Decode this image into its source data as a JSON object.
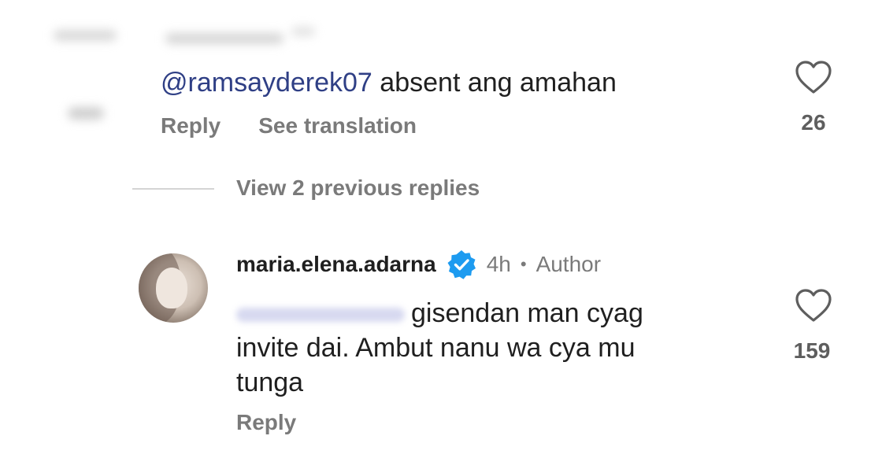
{
  "comment1": {
    "mention": "@ramsayderek07",
    "text": " absent ang amahan",
    "actions": {
      "reply": "Reply",
      "translate": "See translation"
    },
    "likes": "26"
  },
  "view_replies": "View 2 previous replies",
  "reply": {
    "username": "maria.elena.adarna",
    "time": "4h",
    "separator": "•",
    "badge": "Author",
    "text_line1": "gisendan man cyag",
    "text_line2": "invite dai. Ambut nanu wa cya mu",
    "text_line3": "tunga",
    "reply_label": "Reply",
    "likes": "159"
  },
  "icons": {
    "like": "heart-outline-icon",
    "verified": "verified-badge-icon"
  },
  "colors": {
    "mention": "#2f3f85",
    "secondary_text": "#7a7a7a",
    "verified": "#1d9bf0"
  }
}
